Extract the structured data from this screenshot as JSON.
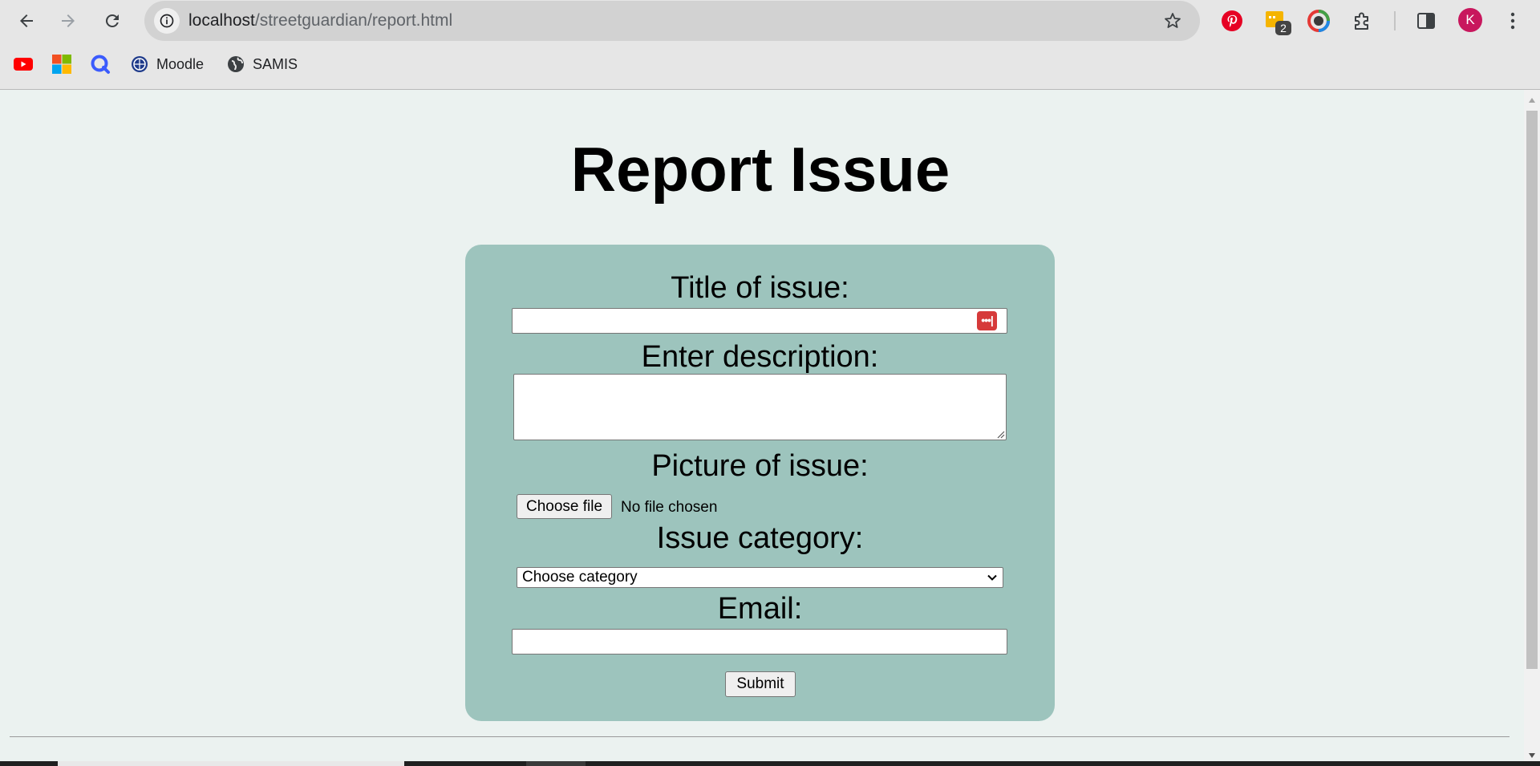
{
  "browser": {
    "url_host": "localhost",
    "url_path": "/streetguardian/report.html",
    "extension_badge": "2",
    "profile_initial": "K"
  },
  "bookmarks": [
    {
      "label": "",
      "icon": "youtube-icon"
    },
    {
      "label": "",
      "icon": "microsoft-icon"
    },
    {
      "label": "",
      "icon": "q-app-icon"
    },
    {
      "label": "Moodle",
      "icon": "moodle-icon"
    },
    {
      "label": "SAMIS",
      "icon": "globe-icon"
    }
  ],
  "page": {
    "title": "Report Issue"
  },
  "form": {
    "title_label": "Title of issue:",
    "title_value": "",
    "description_label": "Enter description:",
    "description_value": "",
    "picture_label": "Picture of issue:",
    "file_button": "Choose file",
    "file_status": "No file chosen",
    "category_label": "Issue category:",
    "category_selected": "Choose category",
    "email_label": "Email:",
    "email_value": "",
    "submit_label": "Submit"
  },
  "colors": {
    "page_bg": "#ebf2f0",
    "card_bg": "#9dc4bd"
  }
}
